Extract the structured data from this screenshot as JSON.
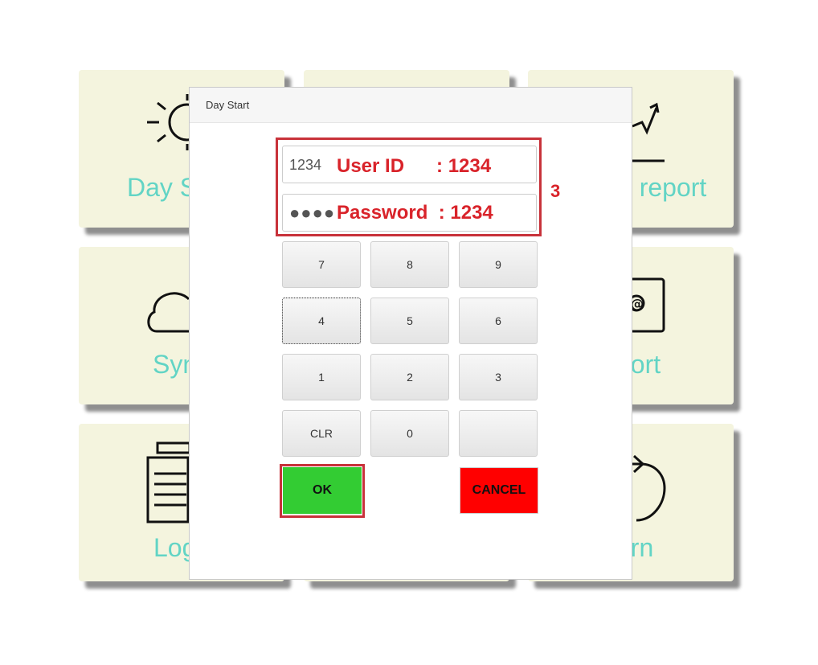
{
  "tiles": {
    "day_start": {
      "label": "Day S",
      "icon": "sun-icon"
    },
    "trend_report": {
      "label": "d report",
      "icon": "trend-chart-icon"
    },
    "sync": {
      "label": "Syn",
      "icon": "cloud-icon"
    },
    "email_report": {
      "label": "port",
      "icon": "email-icon"
    },
    "logs": {
      "label": "Log",
      "icon": "document-icon"
    },
    "return": {
      "label": "urn",
      "icon": "return-arrow-icon"
    }
  },
  "modal": {
    "title": "Day Start",
    "user_id_value": "1234",
    "password_mask": "●●●●",
    "annotation": {
      "user_id": "User ID      : 1234",
      "password": "Password  : 1234",
      "step": "3",
      "color": "#d9232a"
    },
    "keypad": {
      "row1": [
        "7",
        "8",
        "9"
      ],
      "row2": [
        "4",
        "5",
        "6"
      ],
      "row3": [
        "1",
        "2",
        "3"
      ],
      "row4": [
        "CLR",
        "0",
        ""
      ]
    },
    "ok_label": "OK",
    "cancel_label": "CANCEL"
  },
  "colors": {
    "tile_bg": "#f4f4de",
    "tile_label": "#62d4c5",
    "ok": "#33cc33",
    "cancel": "#ff0000"
  }
}
